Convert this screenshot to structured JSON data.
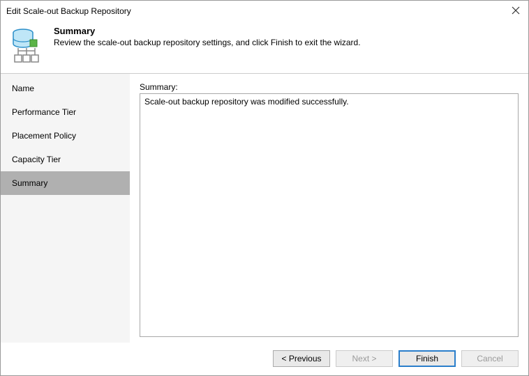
{
  "window": {
    "title": "Edit Scale-out Backup Repository"
  },
  "header": {
    "title": "Summary",
    "description": "Review the scale-out backup repository settings, and click Finish to exit the wizard."
  },
  "sidebar": {
    "items": [
      {
        "label": "Name",
        "active": false
      },
      {
        "label": "Performance Tier",
        "active": false
      },
      {
        "label": "Placement Policy",
        "active": false
      },
      {
        "label": "Capacity Tier",
        "active": false
      },
      {
        "label": "Summary",
        "active": true
      }
    ]
  },
  "main": {
    "summary_label": "Summary:",
    "summary_text": "Scale-out backup repository was modified successfully."
  },
  "footer": {
    "previous": "< Previous",
    "next": "Next >",
    "finish": "Finish",
    "cancel": "Cancel"
  }
}
